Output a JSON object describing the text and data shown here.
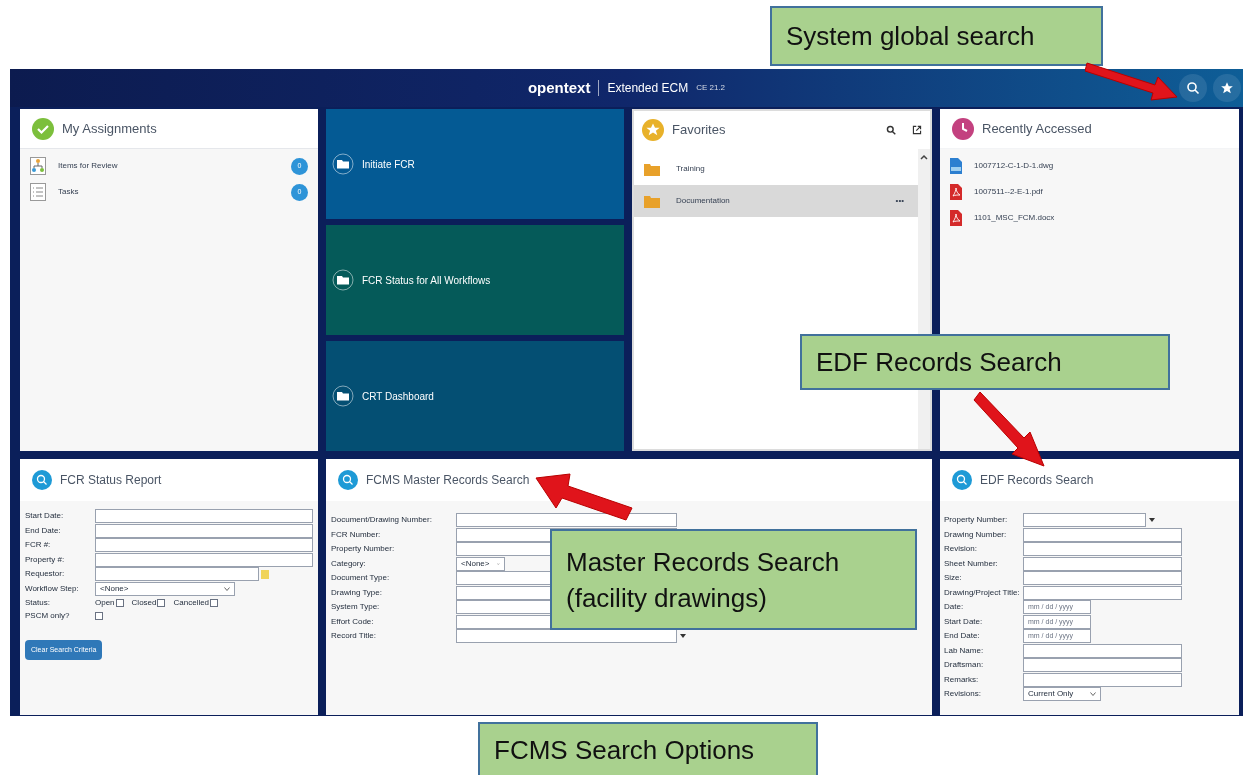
{
  "header": {
    "logo": "opentext",
    "product": "Extended ECM",
    "version": "CE 21.2"
  },
  "assignments": {
    "title": "My Assignments",
    "items": [
      {
        "label": "Items for Review",
        "count": "0",
        "kind": "review"
      },
      {
        "label": "Tasks",
        "count": "0",
        "kind": "tasks"
      }
    ]
  },
  "tiles": [
    {
      "label": "Initiate FCR",
      "color": "#045a94"
    },
    {
      "label": "FCR Status for All Workflows",
      "color": "#055a59"
    },
    {
      "label": "CRT Dashboard",
      "color": "#044f73"
    }
  ],
  "favorites": {
    "title": "Favorites",
    "items": [
      {
        "label": "Training",
        "selected": false
      },
      {
        "label": "Documentation",
        "selected": true,
        "more": "•••"
      }
    ]
  },
  "recent": {
    "title": "Recently Accessed",
    "items": [
      {
        "name": "1007712-C-1-D-1.dwg",
        "kind": "dwg"
      },
      {
        "name": "1007511--2-E-1.pdf",
        "kind": "pdf"
      },
      {
        "name": "1101_MSC_FCM.docx",
        "kind": "pdf"
      }
    ]
  },
  "fcr_report": {
    "title": "FCR Status Report",
    "fields": [
      {
        "label": "Start Date:",
        "kind": "text"
      },
      {
        "label": "End Date:",
        "kind": "text"
      },
      {
        "label": "FCR #:",
        "kind": "text"
      },
      {
        "label": "Property #:",
        "kind": "text"
      },
      {
        "label": "Requestor:",
        "kind": "lookup"
      },
      {
        "label": "Workflow Step:",
        "kind": "select",
        "value": "<None>"
      }
    ],
    "status": {
      "label": "Status:",
      "options": [
        {
          "label": "Open",
          "checked": false
        },
        {
          "label": "Closed",
          "checked": false
        },
        {
          "label": "Cancelled",
          "checked": false
        }
      ]
    },
    "pscm": {
      "label": "PSCM only?",
      "checked": false
    },
    "button": "Clear Search Criteria"
  },
  "master_search": {
    "title": "FCMS Master Records Search",
    "fields": [
      {
        "label": "Document/Drawing Number:",
        "kind": "text"
      },
      {
        "label": "FCR Number:",
        "kind": "text"
      },
      {
        "label": "Property Number:",
        "kind": "text"
      },
      {
        "label": "Category:",
        "kind": "select",
        "value": "<None>"
      },
      {
        "label": "Document Type:",
        "kind": "text"
      },
      {
        "label": "Drawing Type:",
        "kind": "text"
      },
      {
        "label": "System Type:",
        "kind": "text"
      },
      {
        "label": "Effort Code:",
        "kind": "text"
      },
      {
        "label": "Record Title:",
        "kind": "combo"
      }
    ]
  },
  "edf_search": {
    "title": "EDF Records Search",
    "fields": [
      {
        "label": "Property Number:",
        "kind": "combo"
      },
      {
        "label": "Drawing Number:",
        "kind": "text"
      },
      {
        "label": "Revision:",
        "kind": "text"
      },
      {
        "label": "Sheet Number:",
        "kind": "text"
      },
      {
        "label": "Size:",
        "kind": "text"
      },
      {
        "label": "Drawing/Project Title:",
        "kind": "text"
      },
      {
        "label": "Date:",
        "kind": "date",
        "placeholder": "mm / dd / yyyy"
      },
      {
        "label": "Start Date:",
        "kind": "date",
        "placeholder": "mm / dd / yyyy"
      },
      {
        "label": "End Date:",
        "kind": "date",
        "placeholder": "mm / dd / yyyy"
      },
      {
        "label": "Lab Name:",
        "kind": "text"
      },
      {
        "label": "Draftsman:",
        "kind": "text"
      },
      {
        "label": "Remarks:",
        "kind": "text"
      },
      {
        "label": "Revisions:",
        "kind": "select",
        "value": "Current Only"
      }
    ]
  },
  "callouts": [
    {
      "text": "System global search"
    },
    {
      "text": "EDF Records Search"
    },
    {
      "text": "Master Records Search (facility drawings)"
    },
    {
      "text": "FCMS Search Options"
    }
  ]
}
